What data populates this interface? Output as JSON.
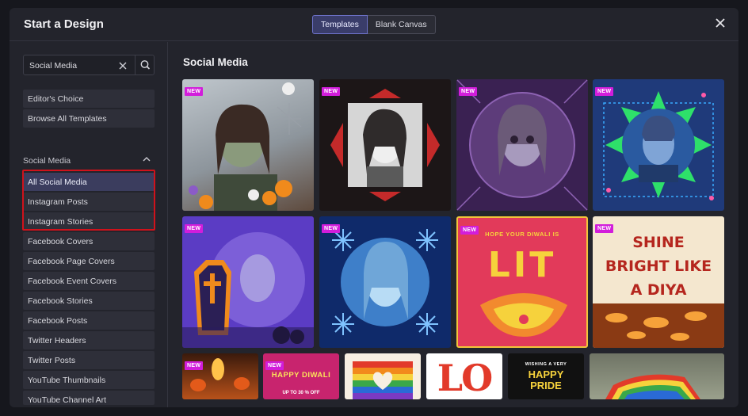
{
  "header": {
    "title": "Start a Design",
    "tabs": [
      {
        "label": "Templates",
        "active": true
      },
      {
        "label": "Blank Canvas",
        "active": false
      }
    ],
    "close_icon": "close-icon"
  },
  "search": {
    "value": "Social Media",
    "clear_icon": "clear-icon",
    "search_icon": "search-icon"
  },
  "sidebar": {
    "top_items": [
      "Editor's Choice",
      "Browse All Templates"
    ],
    "section_label": "Social Media",
    "section_expanded": true,
    "items": [
      "All Social Media",
      "Instagram Posts",
      "Instagram Stories",
      "Facebook Covers",
      "Facebook Page Covers",
      "Facebook Event Covers",
      "Facebook Stories",
      "Facebook Posts",
      "Twitter Headers",
      "Twitter Posts",
      "YouTube Thumbnails",
      "YouTube Channel Art"
    ],
    "selected_item": "All Social Media"
  },
  "content": {
    "title": "Social Media",
    "badge": "NEW",
    "templates": [
      {
        "name": "halloween-zombie-girl",
        "new": true
      },
      {
        "name": "gothic-frame-portrait",
        "new": true
      },
      {
        "name": "purple-zombie-face",
        "new": true
      },
      {
        "name": "blue-man-starburst",
        "new": true
      },
      {
        "name": "skeleton-coffin",
        "new": true
      },
      {
        "name": "snowflake-woman",
        "new": true
      },
      {
        "name": "diwali-lit",
        "new": true,
        "subtitle": "HOPE YOUR DIWALI IS",
        "headline": "LIT"
      },
      {
        "name": "diwali-diya",
        "new": true,
        "headline": "SHINE BRIGHT LIKE A DIYA"
      },
      {
        "name": "candle-photo",
        "new": true
      },
      {
        "name": "happy-diwali-sale",
        "new": true,
        "headline": "HAPPY DIWALI",
        "subtitle": "UP TO 30 % OFF"
      },
      {
        "name": "pride-heart",
        "new": false
      },
      {
        "name": "pride-lo",
        "new": false,
        "headline": "LO"
      },
      {
        "name": "happy-pride",
        "new": false,
        "subtitle": "WISHING A VERY",
        "headline": "HAPPY PRIDE"
      },
      {
        "name": "rainbow-flag-photo",
        "new": false
      }
    ]
  },
  "colors": {
    "accent": "#6d72c9",
    "badge": "#d21ddb",
    "highlight": "#d0121b"
  }
}
